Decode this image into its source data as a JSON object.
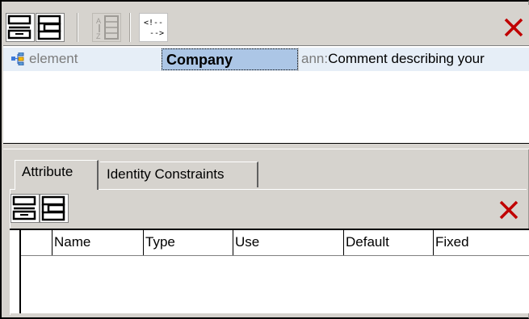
{
  "colors": {
    "chrome": "#d6d3ce",
    "row_highlight": "#e6eef7",
    "name_selected": "#acc6e6",
    "close_red": "#c00000"
  },
  "toolbar": {
    "buttons": [
      {
        "icon": "append-row-icon"
      },
      {
        "icon": "insert-row-icon"
      },
      {
        "icon": "sort-icon",
        "disabled": true
      },
      {
        "icon": "comment-icon",
        "label_line1": "<!--",
        "label_line2": "-->"
      }
    ],
    "close_icon": "close-icon"
  },
  "element_row": {
    "type_icon": "element-icon",
    "type_label": "element",
    "name": "Company",
    "ann_prefix": "ann:",
    "ann_text": "Comment describing your"
  },
  "tabs": [
    {
      "label": "Attribute",
      "active": true
    },
    {
      "label": "Identity Constraints",
      "active": false
    }
  ],
  "attributes_panel": {
    "toolbar": {
      "buttons": [
        {
          "icon": "append-row-icon"
        },
        {
          "icon": "insert-row-icon"
        }
      ],
      "close_icon": "close-icon"
    },
    "columns": [
      "Name",
      "Type",
      "Use",
      "Default",
      "Fixed"
    ]
  }
}
